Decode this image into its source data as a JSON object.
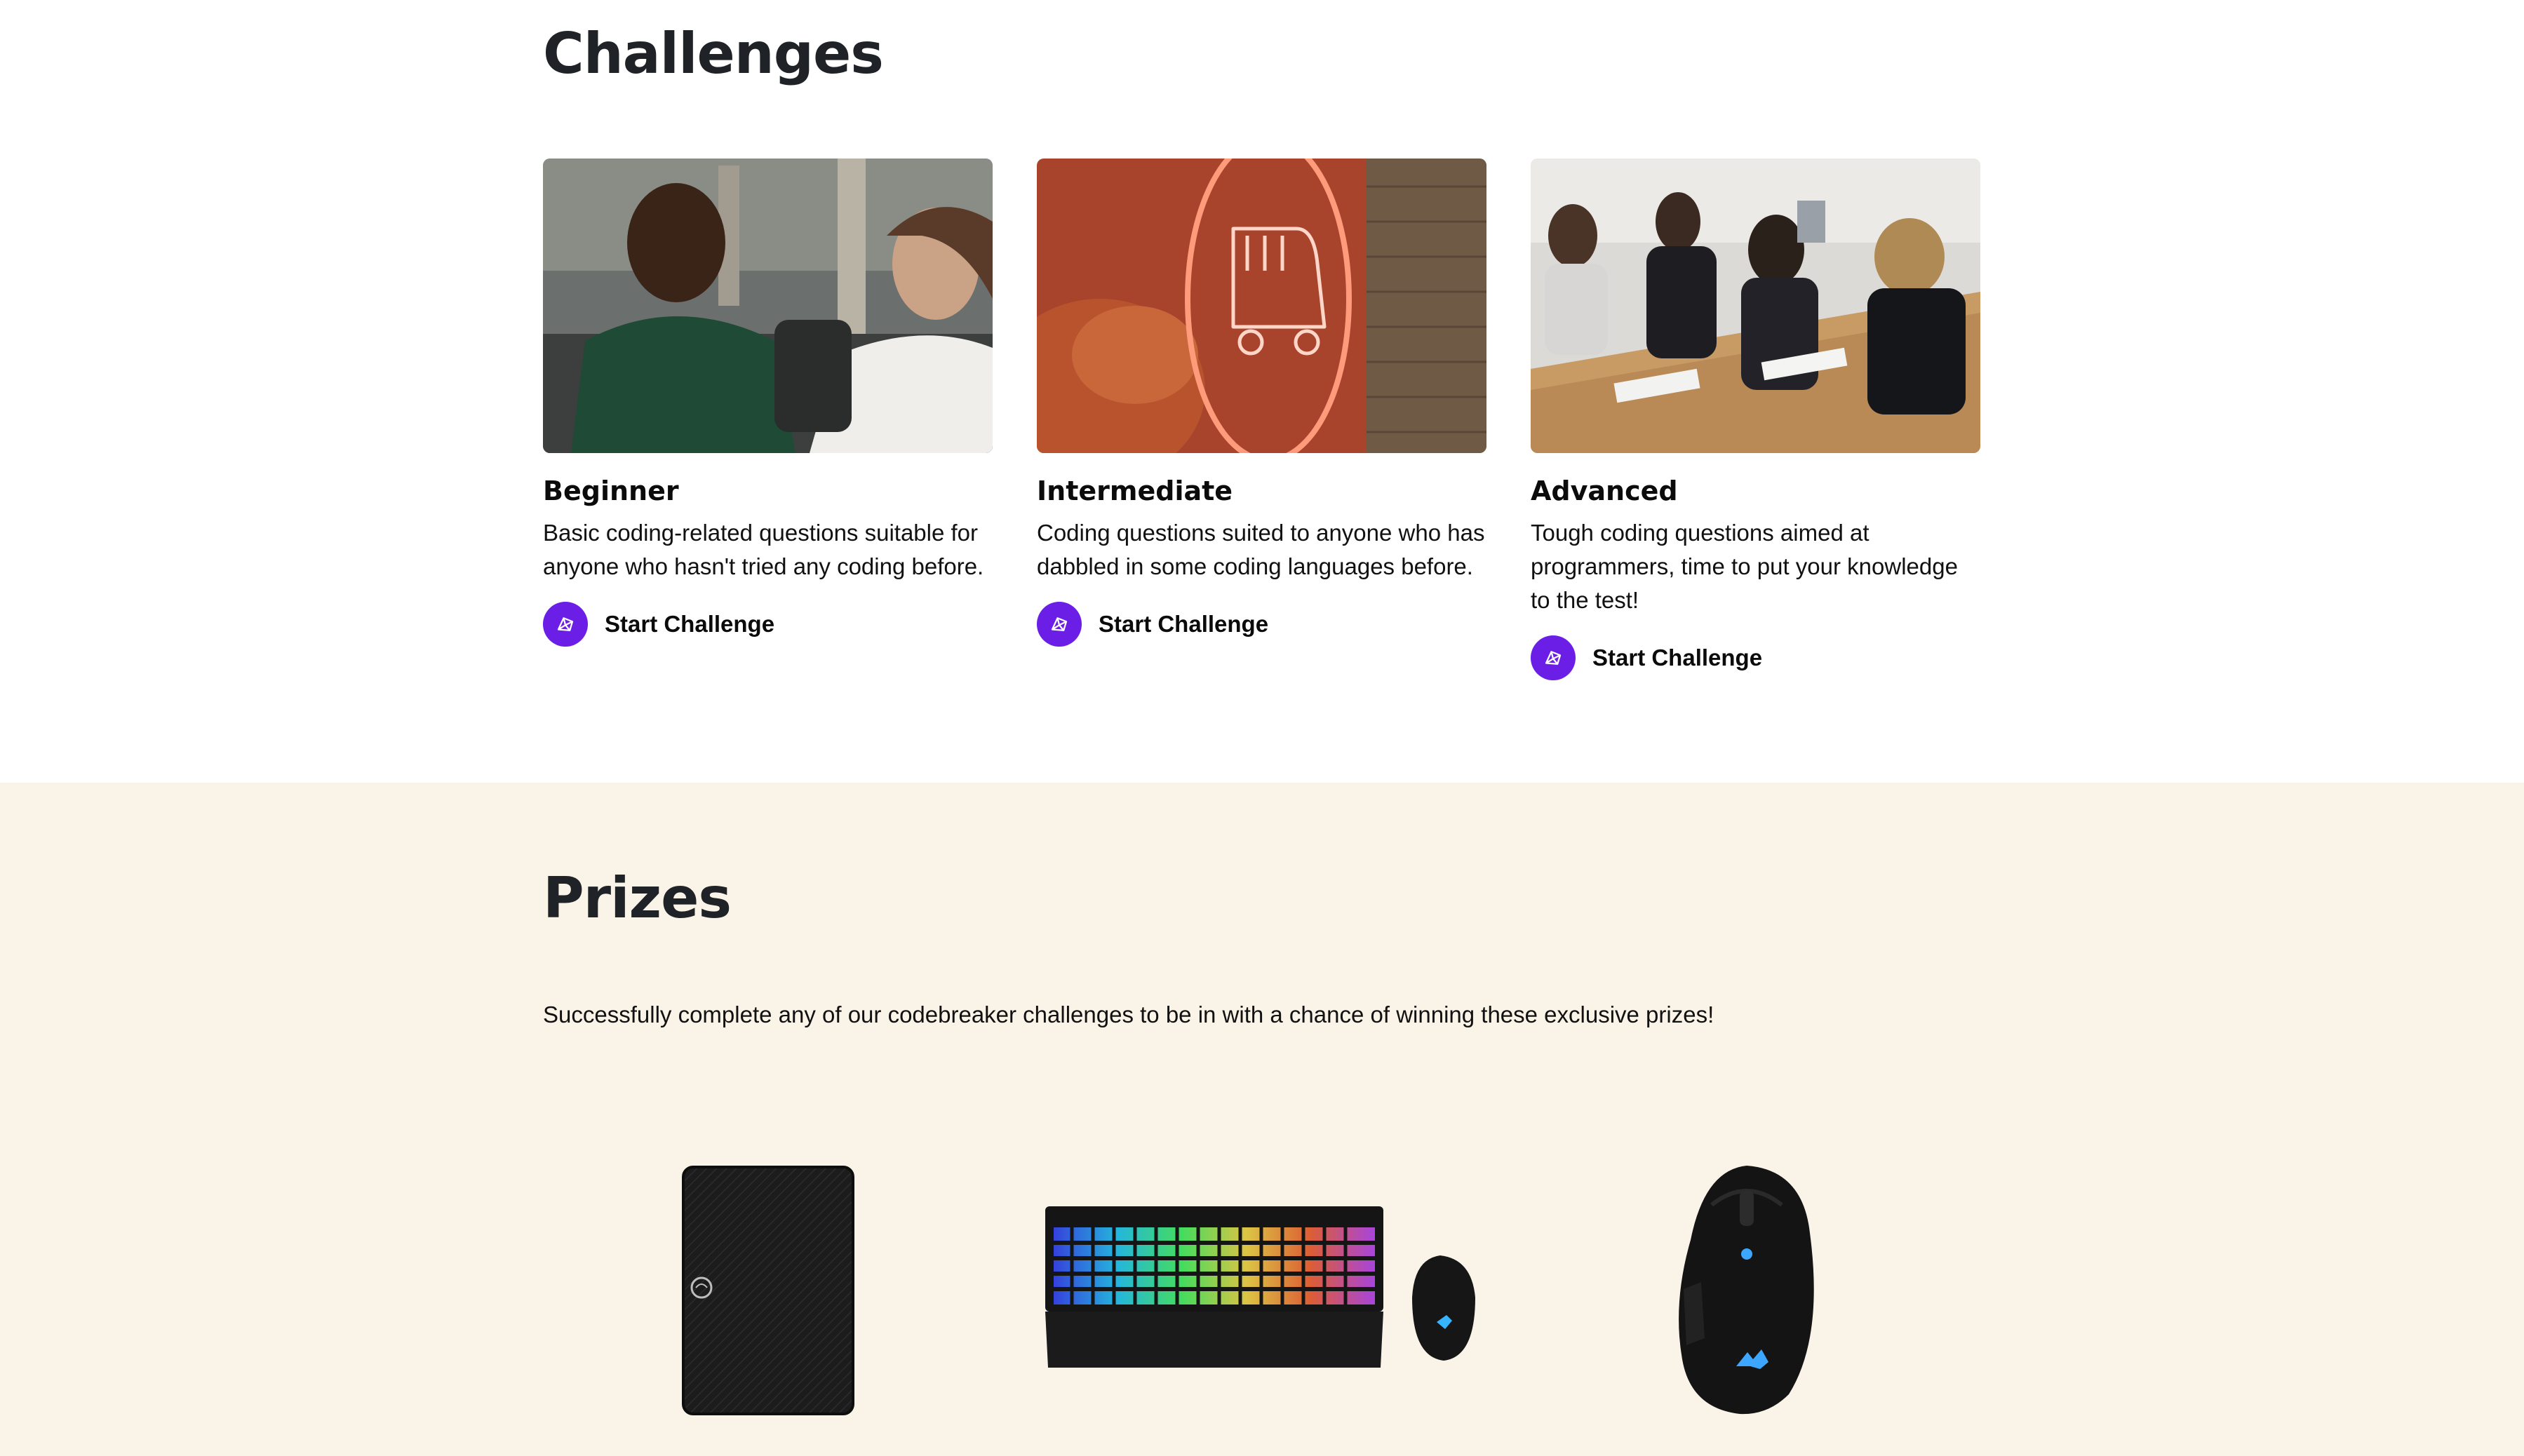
{
  "challenges": {
    "title": "Challenges",
    "cards": [
      {
        "title": "Beginner",
        "description": "Basic coding-related questions suitable for anyone who hasn't tried any coding before.",
        "cta_label": "Start Challenge"
      },
      {
        "title": "Intermediate",
        "description": "Coding questions suited to anyone who has dabbled in some coding languages before.",
        "cta_label": "Start Challenge"
      },
      {
        "title": "Advanced",
        "description": "Tough coding questions aimed at programmers, time to put your knowledge to the test!",
        "cta_label": "Start Challenge"
      }
    ]
  },
  "prizes": {
    "title": "Prizes",
    "intro": "Successfully complete any of our codebreaker challenges to be in with a chance of winning these exclusive prizes!",
    "items": [
      {
        "icon": "external-hard-drive-image"
      },
      {
        "icon": "keyboard-and-mouse-image"
      },
      {
        "icon": "gaming-mouse-image"
      }
    ]
  },
  "colors": {
    "accent": "#6a1ee6",
    "prizes_background": "#faf3e8",
    "heading": "#1f2226"
  }
}
